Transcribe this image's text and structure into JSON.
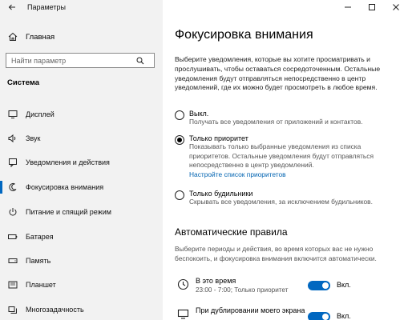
{
  "window": {
    "title": "Параметры"
  },
  "sidebar": {
    "home_label": "Главная",
    "search_placeholder": "Найти параметр",
    "section_title": "Система",
    "items": [
      {
        "label": "Дисплей",
        "icon": "display-icon"
      },
      {
        "label": "Звук",
        "icon": "sound-icon"
      },
      {
        "label": "Уведомления и действия",
        "icon": "notifications-icon"
      },
      {
        "label": "Фокусировка внимания",
        "icon": "focus-assist-icon",
        "active": true
      },
      {
        "label": "Питание и спящий режим",
        "icon": "power-icon"
      },
      {
        "label": "Батарея",
        "icon": "battery-icon"
      },
      {
        "label": "Память",
        "icon": "storage-icon"
      },
      {
        "label": "Планшет",
        "icon": "tablet-icon"
      },
      {
        "label": "Многозадачность",
        "icon": "multitasking-icon"
      }
    ]
  },
  "main": {
    "title": "Фокусировка внимания",
    "description": "Выберите уведомления, которые вы хотите просматривать и прослушивать, чтобы оставаться сосредоточенным. Остальные уведомления будут отправляться непосредственно в центр уведомлений, где их можно будет просмотреть в любое время.",
    "options": [
      {
        "label": "Выкл.",
        "sub": "Получать все уведомления от приложений и контактов.",
        "selected": false
      },
      {
        "label": "Только приоритет",
        "sub": "Показывать только выбранные уведомления из списка приоритетов. Остальные уведомления будут отправляться непосредственно в центр уведомлений.",
        "link": "Настройте список приоритетов",
        "selected": true
      },
      {
        "label": "Только будильники",
        "sub": "Скрывать все уведомления, за исключением будильников.",
        "selected": false
      }
    ],
    "rules_title": "Автоматические правила",
    "rules_description": "Выберите периоды и действия, во время которых вас не нужно беспокоить, и фокусировка внимания включится автоматически.",
    "rules": [
      {
        "title": "В это время",
        "sub": "23:00 - 7:00; Только приоритет",
        "toggle_label": "Вкл.",
        "on": true,
        "icon": "clock-icon"
      },
      {
        "title": "При дублировании моего экрана",
        "sub": "",
        "toggle_label": "Вкл.",
        "on": true,
        "icon": "monitor-icon"
      }
    ]
  },
  "colors": {
    "accent": "#0067c0",
    "link": "#0063b1",
    "sidebar_bg": "#f2f2f2"
  }
}
